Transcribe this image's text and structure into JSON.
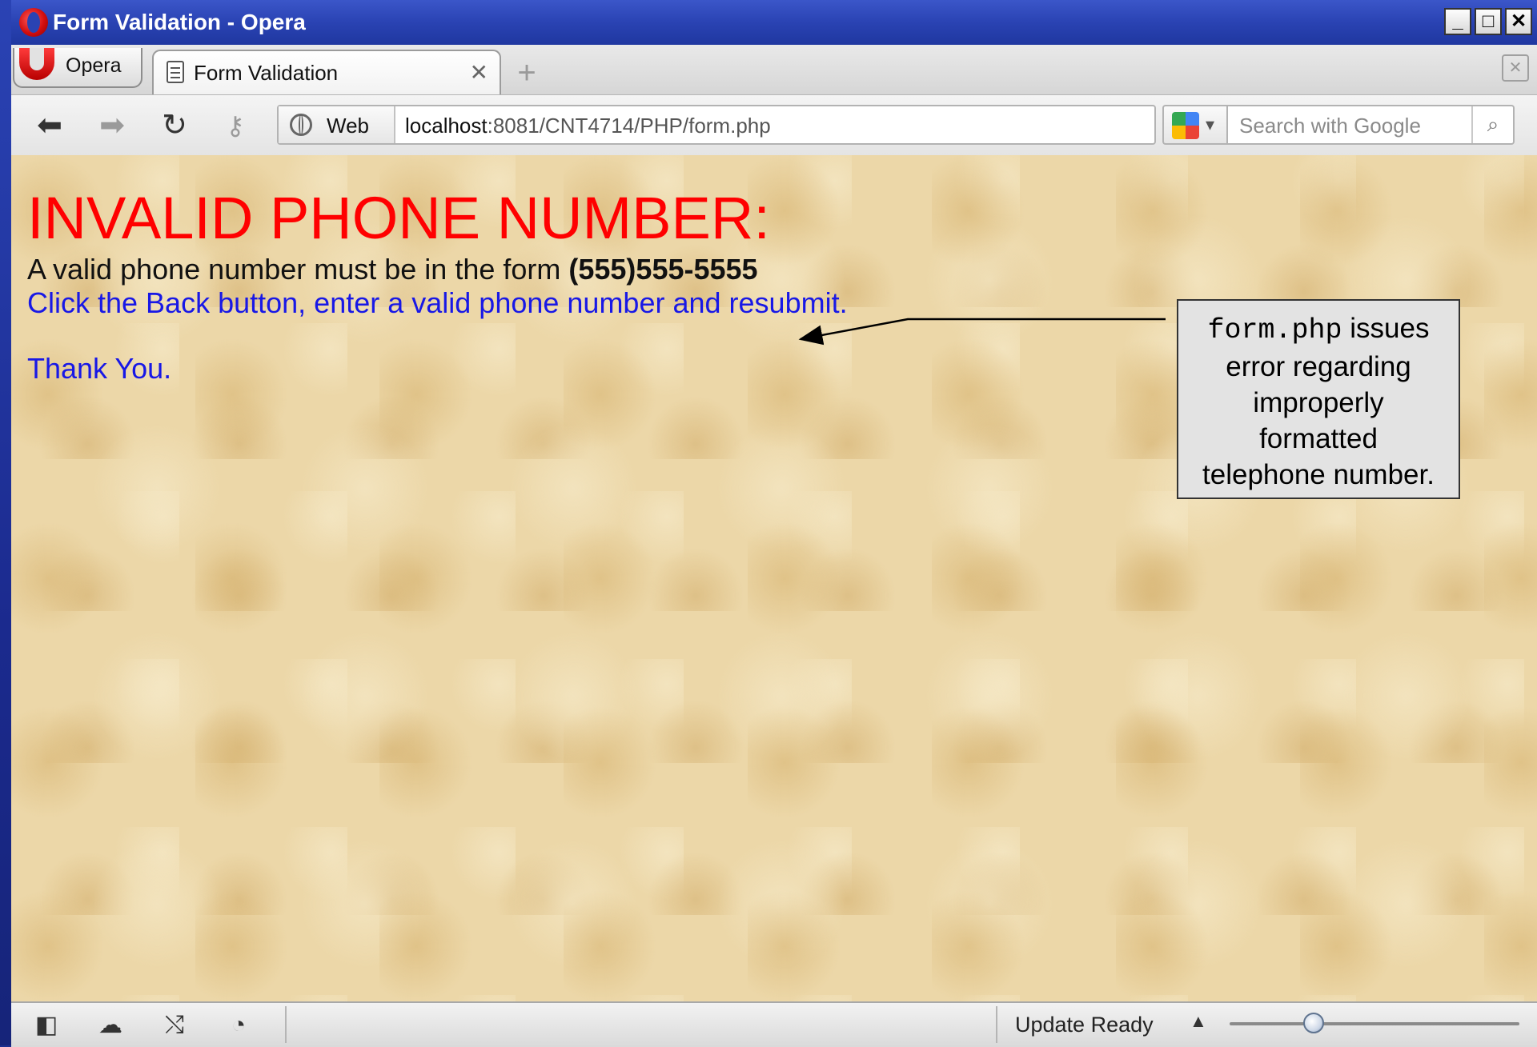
{
  "window": {
    "title": "Form Validation - Opera",
    "minimize": "_",
    "maximize": "□",
    "close": "✕"
  },
  "menu": {
    "opera_label": "Opera"
  },
  "tabs": [
    {
      "label": "Form Validation",
      "close": "✕"
    }
  ],
  "newtab_symbol": "+",
  "address": {
    "scope_label": "Web",
    "url_host": "localhost",
    "url_rest": ":8081/CNT4714/PHP/form.php"
  },
  "search": {
    "placeholder": "Search with Google"
  },
  "page": {
    "heading": "INVALID PHONE NUMBER:",
    "line1_text": "A valid phone number must be in the form ",
    "line1_bold": "(555)555-5555",
    "line2": "Click the Back button, enter a valid phone number and resubmit.",
    "line3": "Thank You."
  },
  "callout": {
    "code": "form.php",
    "text_1": " issues",
    "text_2": "error regarding",
    "text_3": "improperly",
    "text_4": "formatted",
    "text_5": "telephone number."
  },
  "statusbar": {
    "update_label": "Update Ready",
    "caret": "▲"
  },
  "zoom": {
    "level": 0.25
  },
  "colors": {
    "heading": "#ff0000",
    "link_text": "#1818e6",
    "title_bar": "#2a43b3",
    "page_background": "#ecd7a8"
  },
  "icons": {
    "back": "back-arrow-icon",
    "forward": "forward-arrow-icon",
    "reload": "reload-icon",
    "key": "key-icon",
    "globe": "globe-icon",
    "google": "google-icon",
    "search": "magnifier-icon",
    "panel": "panel-toggle-icon",
    "cloud": "cloud-icon",
    "share": "share-icon",
    "speed": "speedometer-icon"
  }
}
